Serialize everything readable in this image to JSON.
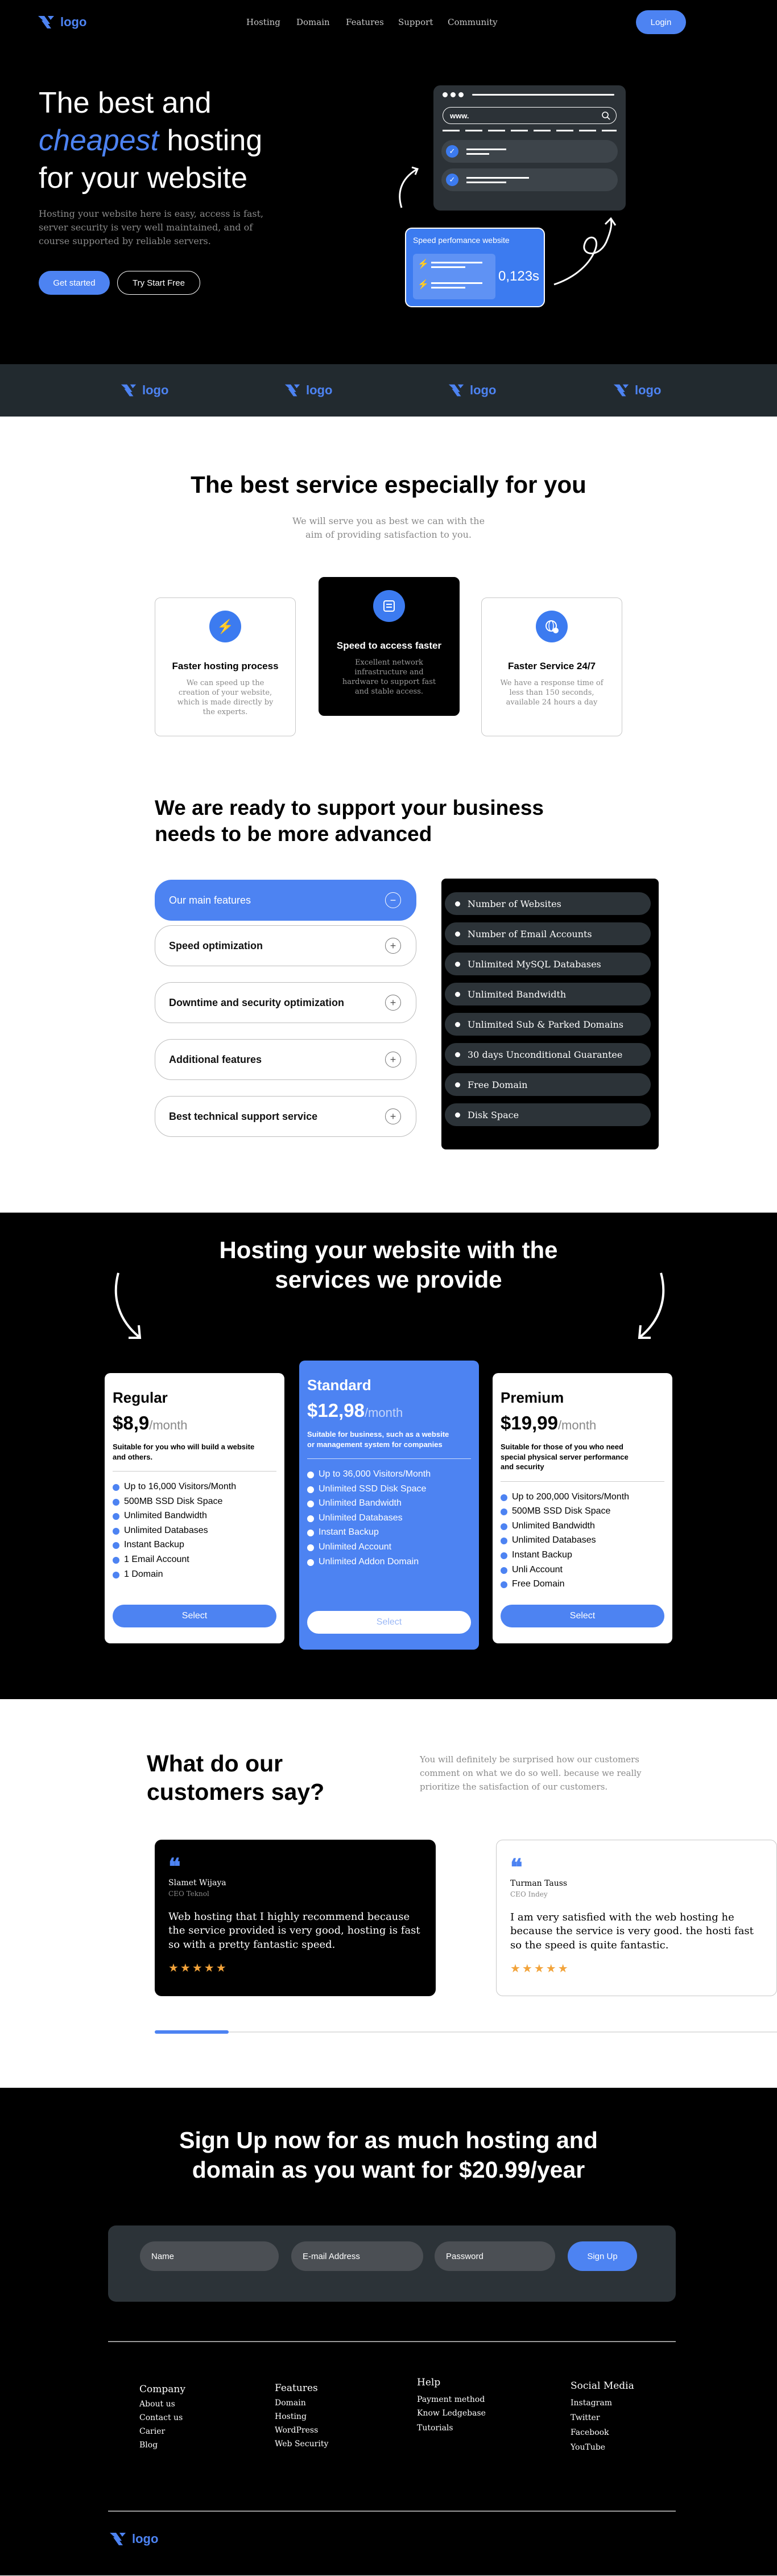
{
  "brand": {
    "logo": "logo",
    "accent": "#4d83f2",
    "icon": "logo-mark-icon"
  },
  "nav": {
    "items": [
      "Hosting",
      "Domain",
      "Features",
      "Support",
      "Community"
    ],
    "login": "Login"
  },
  "hero": {
    "title_line1": "The best and",
    "title_highlight": "cheapest",
    "title_line2_rest": "hosting",
    "title_line3": "for your website",
    "subtitle": "Hosting your website here is easy, access is fast, server security is very well maintained, and of course supported by reliable servers.",
    "cta_primary": "Get started",
    "cta_secondary": "Try Start Free",
    "browser_url": "www.",
    "speed_card_title": "Speed perfomance website",
    "speed_value": "0,123s"
  },
  "logos": [
    "logo",
    "logo",
    "logo",
    "logo"
  ],
  "service": {
    "heading": "The best service especially for you",
    "subheading": "We will serve you as best we can with the aim of providing satisfaction to you.",
    "cards": [
      {
        "title": "Faster hosting process",
        "desc": "We can speed up the creation of your website, which is made directly by the experts.",
        "icon": "lightning-icon"
      },
      {
        "title": "Speed to access faster",
        "desc": "Excellent network infrastructure and hardware to support fast and stable access.",
        "icon": "server-icon"
      },
      {
        "title": "Faster Service 24/7",
        "desc": "We have a response time of less than 150 seconds, available 24 hours a day",
        "icon": "globe-icon"
      }
    ]
  },
  "support": {
    "heading": "We are ready to support your business needs to be more advanced",
    "accordion": [
      "Our main features",
      "Speed optimization",
      "Downtime and security optimization",
      "Additional features",
      "Best technical support service"
    ],
    "features": [
      "Number of Websites",
      "Number of Email Accounts",
      "Unlimited MySQL Databases",
      "Unlimited Bandwidth",
      "Unlimited Sub & Parked Domains",
      "30 days Unconditional Guarantee",
      "Free Domain",
      "Disk Space"
    ]
  },
  "pricing": {
    "heading": "Hosting your website with the services we provide",
    "plans": [
      {
        "name": "Regular",
        "price": "$8,9",
        "period": "/month",
        "desc": "Suitable for you who will build a website and others.",
        "features": [
          "Up to 16,000 Visitors/Month",
          "500MB SSD Disk Space",
          "Unlimited Bandwidth",
          "Unlimited Databases",
          "Instant Backup",
          "1 Email Account",
          "1 Domain"
        ],
        "button": "Select"
      },
      {
        "name": "Standard",
        "price": "$12,98",
        "period": "/month",
        "desc": "Suitable for business, such as a website or management system for companies",
        "features": [
          "Up to 36,000 Visitors/Month",
          "Unlimited SSD Disk Space",
          "Unlimited Bandwidth",
          "Unlimited Databases",
          "Instant Backup",
          "Unlimited Account",
          "Unlimited Addon Domain"
        ],
        "button": "Select"
      },
      {
        "name": "Premium",
        "price": "$19,99",
        "period": "/month",
        "desc": "Suitable for those of you who need special physical server performance and security",
        "features": [
          "Up to 200,000 Visitors/Month",
          "500MB SSD Disk Space",
          "Unlimited Bandwidth",
          "Unlimited Databases",
          "Instant Backup",
          "Unli Account",
          "Free Domain"
        ],
        "button": "Select"
      }
    ]
  },
  "testimonials": {
    "heading": "What do our customers say?",
    "intro": "You will definitely be surprised how our customers comment on what we do so well. because we really prioritize the satisfaction of our customers.",
    "items": [
      {
        "name": "Slamet Wijaya",
        "role": "CEO Teknol",
        "text": "Web hosting that I highly recommend because the service provided is very good, hosting is fast so with a pretty fantastic speed.",
        "stars": "★★★★★"
      },
      {
        "name": "Turman Tauss",
        "role": "CEO Indey",
        "text": "I am very satisfied with the web hosting he because the service is very good. the hosti fast so the speed is quite fantastic.",
        "stars": "★★★★★"
      }
    ]
  },
  "signup": {
    "heading": "Sign Up now for as much hosting and domain as you want for $20.99/year",
    "name_placeholder": "Name",
    "email_placeholder": "E-mail Address",
    "password_placeholder": "Password",
    "button": "Sign Up"
  },
  "footer": {
    "columns": [
      {
        "title": "Company",
        "links": [
          "About us",
          "Contact us",
          "Carier",
          "Blog"
        ]
      },
      {
        "title": "Features",
        "links": [
          "Domain",
          "Hosting",
          "WordPress",
          "Web Security"
        ]
      },
      {
        "title": "Help",
        "links": [
          "Payment method",
          "Know Ledgebase",
          "Tutorials"
        ]
      },
      {
        "title": "Social Media",
        "links": [
          "Instagram",
          "Twitter",
          "Facebook",
          "YouTube"
        ]
      }
    ],
    "logo": "logo"
  }
}
